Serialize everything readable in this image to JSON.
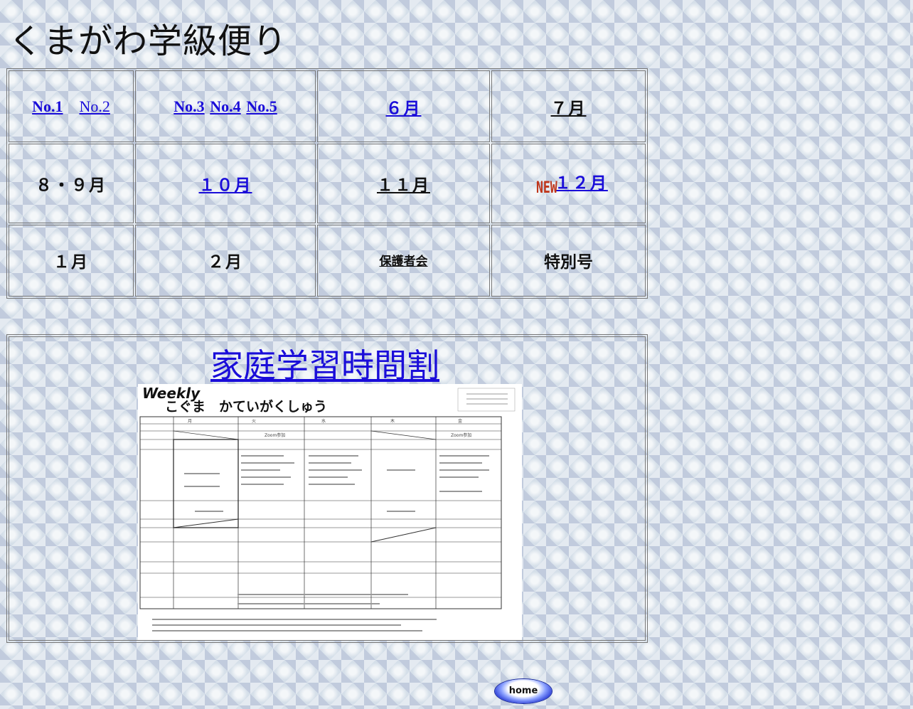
{
  "page": {
    "title": "くまがわ学級便り"
  },
  "months_table": {
    "row1": {
      "c1": [
        "No.1",
        "No.2"
      ],
      "c2": [
        "No.3",
        "No.4",
        "No.5"
      ],
      "c3": "６月",
      "c4": "７月"
    },
    "row2": {
      "c1": "８・９月",
      "c2": "１０月",
      "c3": "１１月",
      "c4_badge": "NEW",
      "c4": "１２月"
    },
    "row3": {
      "c1": "１月",
      "c2": "２月",
      "c3": "保護者会",
      "c4": "特別号"
    }
  },
  "study": {
    "link_label": "家庭学習時間割",
    "sheet": {
      "heading_en": "Weekly",
      "heading_jp": "こぐま　かていがくしゅう",
      "days": [
        "月",
        "火",
        "水",
        "木",
        "金"
      ],
      "zoom_label": "Zoom参加"
    }
  },
  "footer": {
    "home_label": "home"
  }
}
